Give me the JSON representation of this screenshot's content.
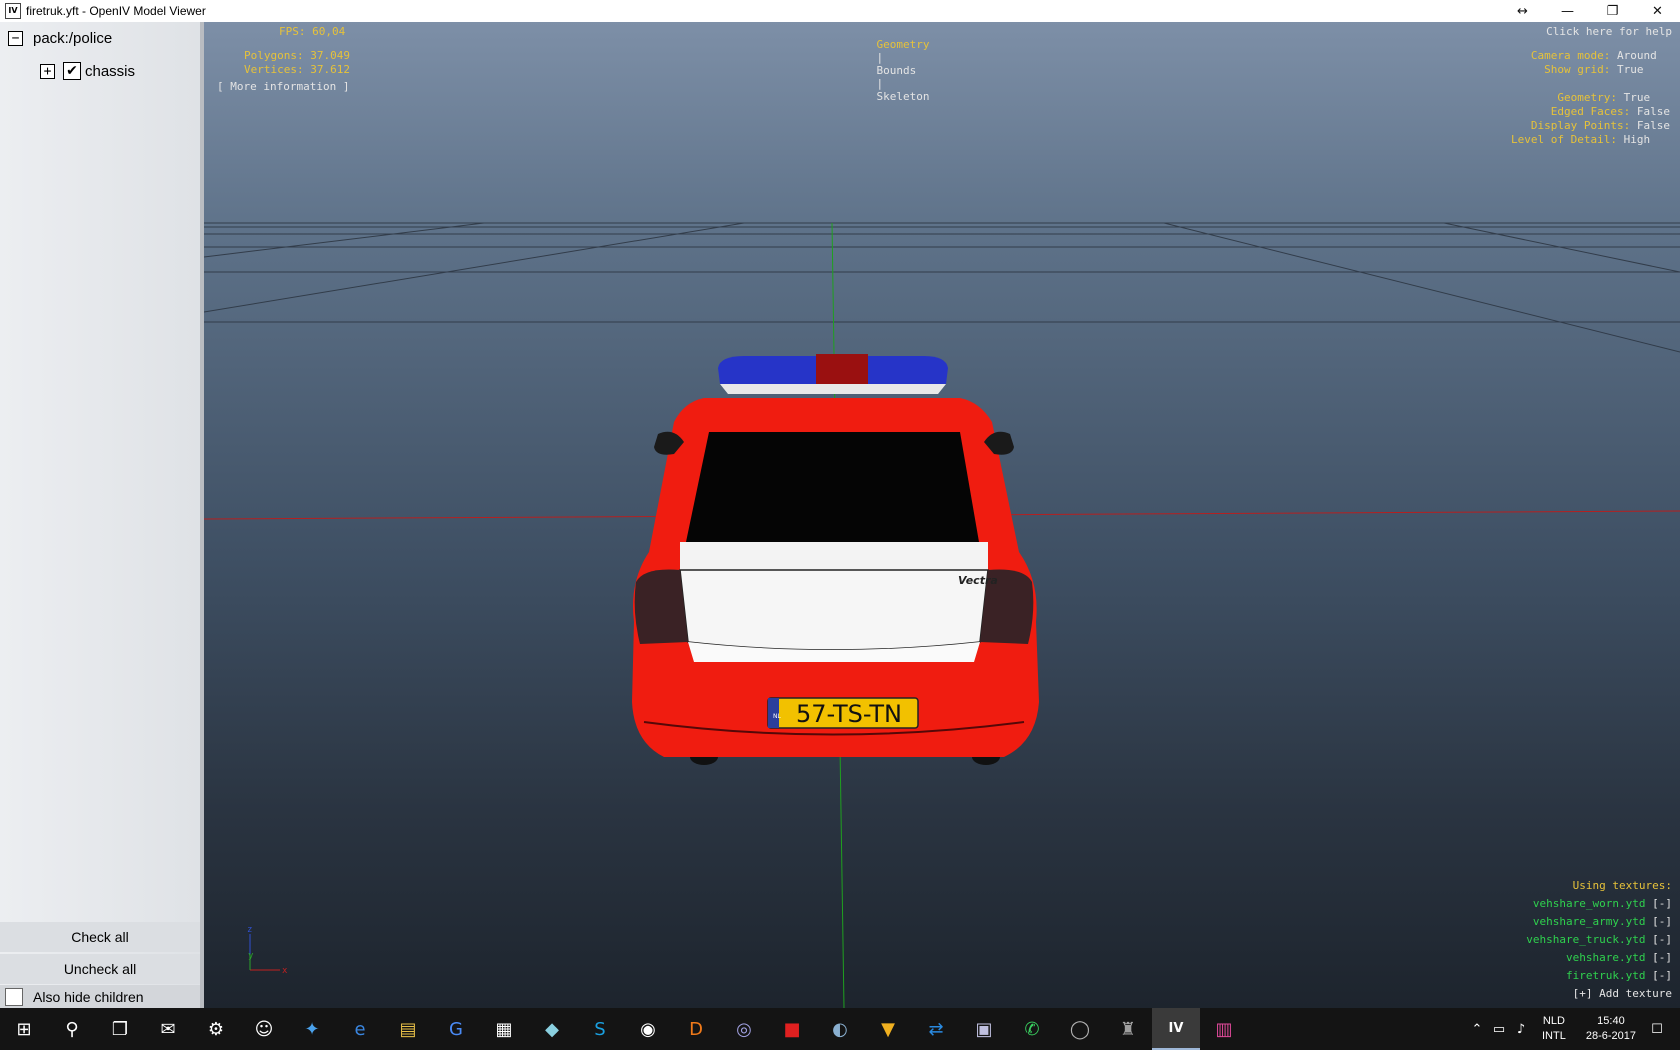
{
  "window": {
    "title": "firetruk.yft - OpenIV Model Viewer",
    "app_icon": "IV",
    "controls": [
      "↔",
      "—",
      "❐",
      "✕"
    ]
  },
  "sidebar": {
    "root_toggle": "−",
    "root_label": "pack:/police",
    "child_toggle": "+",
    "child_checked": "✔",
    "child_label": "chassis",
    "check_all": "Check all",
    "uncheck_all": "Uncheck all",
    "also_hide_children": "Also hide children"
  },
  "viewport": {
    "fps": "FPS: 60,04",
    "polygons": "Polygons: 37.049",
    "vertices": "Vertices: 37.612",
    "more_info": "[ More information ]",
    "tabs": {
      "geometry": "Geometry",
      "sep1": "|",
      "bounds": "Bounds",
      "sep2": "|",
      "skeleton": "Skeleton"
    },
    "help": "Click here for help",
    "camera_mode_label": "Camera mode:",
    "camera_mode_value": "Around",
    "show_grid_label": "Show grid:",
    "show_grid_value": "True",
    "geometry_label": "Geometry:",
    "geometry_value": "True",
    "edged_faces_label": "Edged Faces:",
    "edged_faces_value": "False",
    "display_points_label": "Display Points:",
    "display_points_value": "False",
    "lod_label": "Level of Detail:",
    "lod_value": "High",
    "using_textures": "Using textures:",
    "textures": [
      {
        "name": "vehshare_worn.ytd",
        "action": "[-]"
      },
      {
        "name": "vehshare_army.ytd",
        "action": "[-]"
      },
      {
        "name": "vehshare_truck.ytd",
        "action": "[-]"
      },
      {
        "name": "vehshare.ytd",
        "action": "[-]"
      },
      {
        "name": "firetruk.ytd",
        "action": "[-]"
      }
    ],
    "add_texture": "[+] Add texture",
    "car_badge": "Vectra",
    "license_plate": "57-TS-TN",
    "plate_country": "NL",
    "axis_z": "z",
    "axis_y": "y",
    "axis_x": "x"
  },
  "taskbar": {
    "icons": [
      {
        "name": "start",
        "glyph": "⊞"
      },
      {
        "name": "search",
        "glyph": "⚲"
      },
      {
        "name": "task-view",
        "glyph": "❐"
      },
      {
        "name": "mail",
        "glyph": "✉"
      },
      {
        "name": "steam",
        "glyph": "⚙"
      },
      {
        "name": "discord",
        "glyph": "☺"
      },
      {
        "name": "twitter",
        "glyph": "✦"
      },
      {
        "name": "edge",
        "glyph": "e"
      },
      {
        "name": "explorer",
        "glyph": "▤"
      },
      {
        "name": "google",
        "glyph": "G"
      },
      {
        "name": "store",
        "glyph": "▦"
      },
      {
        "name": "notes",
        "glyph": "◆"
      },
      {
        "name": "skype",
        "glyph": "S"
      },
      {
        "name": "obs",
        "glyph": "◉"
      },
      {
        "name": "d-app",
        "glyph": "D"
      },
      {
        "name": "app-spiral",
        "glyph": "◎"
      },
      {
        "name": "roblox",
        "glyph": "■"
      },
      {
        "name": "app-bird",
        "glyph": "◐"
      },
      {
        "name": "app-v",
        "glyph": "▼"
      },
      {
        "name": "teamviewer",
        "glyph": "⇄"
      },
      {
        "name": "app-image",
        "glyph": "▣"
      },
      {
        "name": "whatsapp",
        "glyph": "✆"
      },
      {
        "name": "app-disc",
        "glyph": "◯"
      },
      {
        "name": "app-game",
        "glyph": "♜"
      },
      {
        "name": "openiv",
        "glyph": "IV"
      },
      {
        "name": "app-archive",
        "glyph": "▥"
      }
    ],
    "tray": {
      "up": "⌃",
      "network": "▭",
      "volume": "♪",
      "lang_top": "NLD",
      "lang_bottom": "INTL",
      "time": "15:40",
      "date": "28-6-2017",
      "notifications": "☐"
    }
  },
  "colors": {
    "car_body": "#f01c10",
    "hud_yellow": "#e6c23a",
    "hud_green": "#2fd14e",
    "lightbar_blue": "#2634c8",
    "plate_yellow": "#f2c100"
  }
}
